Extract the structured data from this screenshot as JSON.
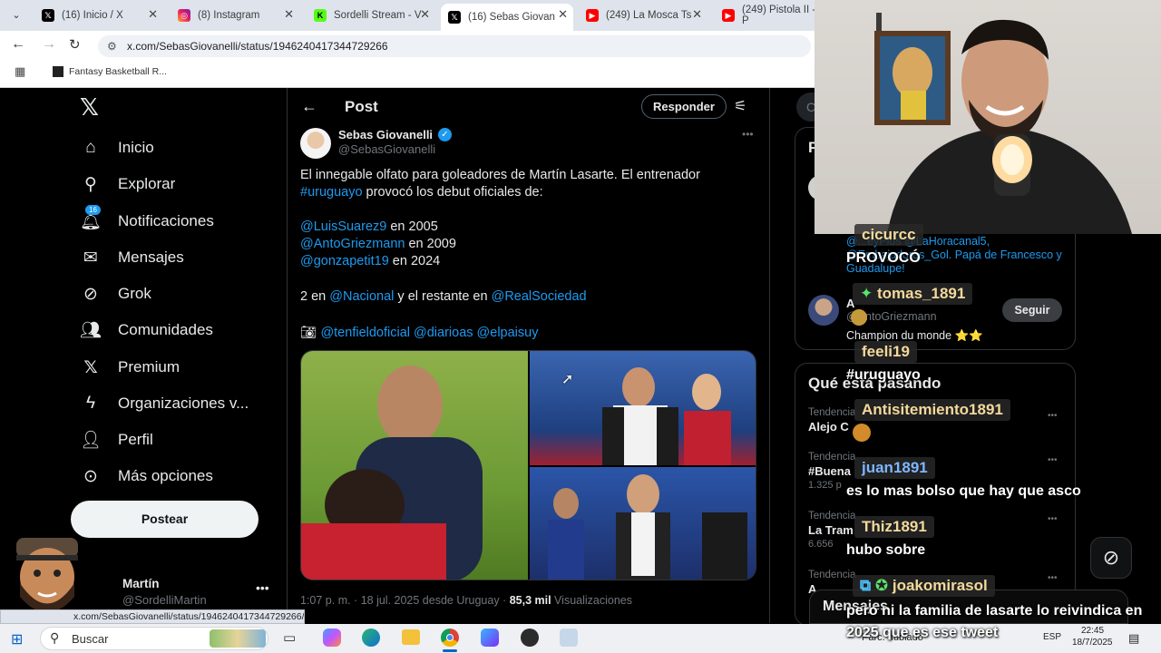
{
  "browser": {
    "tabs": [
      {
        "label": "(16) Inicio / X",
        "icon": "x-logo"
      },
      {
        "label": "(8) Instagram",
        "icon": "instagram"
      },
      {
        "label": "Sordelli Stream - V",
        "icon": "kick"
      },
      {
        "label": "(16) Sebas Giovan",
        "icon": "x-logo"
      },
      {
        "label": "(249) La Mosca Ts",
        "icon": "youtube"
      },
      {
        "label": "(249) Pistola II - P",
        "icon": "youtube"
      }
    ],
    "url": "x.com/SebasGiovanelli/status/1946240417344729266",
    "bookmark": "Fantasy Basketball R...",
    "status_url": "x.com/SebasGiovanelli/status/1946240417344729266/photo/2"
  },
  "sidebar": {
    "items": [
      {
        "label": "Inicio",
        "icon": "home-icon"
      },
      {
        "label": "Explorar",
        "icon": "search-icon"
      },
      {
        "label": "Notificaciones",
        "icon": "bell-icon",
        "badge": "16"
      },
      {
        "label": "Mensajes",
        "icon": "mail-icon"
      },
      {
        "label": "Grok",
        "icon": "grok-icon"
      },
      {
        "label": "Comunidades",
        "icon": "communities-icon"
      },
      {
        "label": "Premium",
        "icon": "x-logo-icon"
      },
      {
        "label": "Organizaciones v...",
        "icon": "lightning-icon"
      },
      {
        "label": "Perfil",
        "icon": "person-icon"
      },
      {
        "label": "Más opciones",
        "icon": "more-circle-icon"
      }
    ],
    "post_button": "Postear",
    "account": {
      "name": "Martín",
      "handle": "@SordelliMartin"
    }
  },
  "post": {
    "header_title": "Post",
    "reply_button": "Responder",
    "author_name": "Sebas Giovanelli",
    "author_handle": "@SebasGiovanelli",
    "line1": "El innegable olfato para goleadores de Martín Lasarte. El entrenador",
    "line2_link": "#uruguayo",
    "line2_rest": " provocó los debut oficiales de:",
    "debuts": [
      {
        "handle": "@LuisSuarez9",
        "year": " en 2005"
      },
      {
        "handle": "@AntoGriezmann",
        "year": " en 2009"
      },
      {
        "handle": "@gonzapetit19",
        "year": " en 2024"
      }
    ],
    "clubs_prefix": "2 en ",
    "club1": "@Nacional",
    "clubs_mid": " y el restante en ",
    "club2": "@RealSociedad",
    "photo_credits": "@tenfieldoficial @diarioas @elpaisuy",
    "meta_time": "1:07 p. m. · 18 jul. 2025 desde Uruguay · ",
    "meta_views": "85,3 mil",
    "meta_views_label": " Visualizaciones"
  },
  "right": {
    "search_partial": "C",
    "relevant_partial": "P",
    "mentions_text": "@...eyPlus @LaHoracanal5, @Embajadores_Gol. Papá de Francesco y Guadalupe!",
    "person_name": "A",
    "person_handle": "@AntoGriezmann",
    "person_bio": "Champion du monde ⭐⭐",
    "follow_button": "Seguir",
    "whats_happening": "Qué está pasando",
    "trends": [
      {
        "context": "Tendencia",
        "title": "Alejo C",
        "count": ""
      },
      {
        "context": "Tendencia",
        "title": "#Buena",
        "count": "1.325 p"
      },
      {
        "context": "Tendencia",
        "title": "La Tram",
        "count": "6.656"
      },
      {
        "context": "Tendencia",
        "title": "A",
        "count": ""
      }
    ],
    "messages_label": "Mensajes"
  },
  "chat": [
    {
      "user": "cicurcc",
      "msg": "PROVOCÓ"
    },
    {
      "user": "tomas_1891",
      "msg": ""
    },
    {
      "user": "feeli19",
      "msg": "#uruguayo"
    },
    {
      "user": "Antisitemiento1891",
      "msg": ""
    },
    {
      "user": "juan1891",
      "msg": "es lo mas bolso que hay que asco"
    },
    {
      "user": "Thiz1891",
      "msg": "hubo sobre"
    },
    {
      "user": "joakomirasol",
      "msg": "pero ni la familia de lasarte lo reivindica en 2025 que es ese tweet"
    }
  ],
  "taskbar": {
    "search_placeholder": "Buscar",
    "lang": "ESP",
    "time": "22:45",
    "date": "18/7/2025",
    "weather": "Parc. nublado"
  }
}
